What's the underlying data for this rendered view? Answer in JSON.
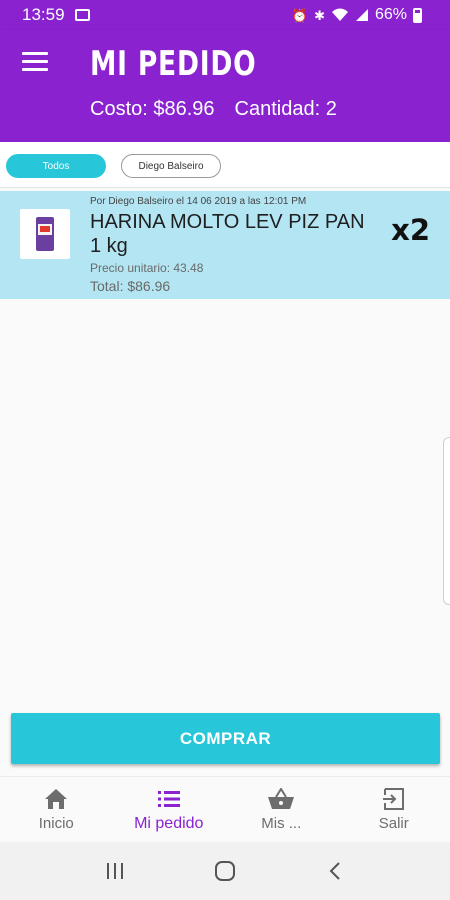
{
  "status_bar": {
    "time": "13:59",
    "battery": "66%"
  },
  "header": {
    "title": "MI PEDIDO",
    "cost": "Costo: $86.96",
    "quantity": "Cantidad: 2"
  },
  "filters": [
    {
      "label": "Todos",
      "selected": true
    },
    {
      "label": "Diego Balseiro",
      "selected": false
    }
  ],
  "order_items": [
    {
      "meta": "Por Diego Balseiro el 14 06 2019 a las 12:01 PM",
      "name": "HARINA MOLTO LEV PIZ PAN 1 kg",
      "unit_price": "Precio unitario: 43.48",
      "total": "Total: $86.96",
      "qty": "x2"
    }
  ],
  "buy_button": "COMPRAR",
  "bottom_nav": [
    {
      "label": "Inicio",
      "icon": "home-icon",
      "active": false
    },
    {
      "label": "Mi pedido",
      "icon": "list-icon",
      "active": true
    },
    {
      "label": "Mis ...",
      "icon": "basket-icon",
      "active": false
    },
    {
      "label": "Salir",
      "icon": "exit-icon",
      "active": false
    }
  ],
  "colors": {
    "primary": "#8a22d0",
    "accent": "#27c6d8",
    "selected_row": "#b3e5f3"
  }
}
